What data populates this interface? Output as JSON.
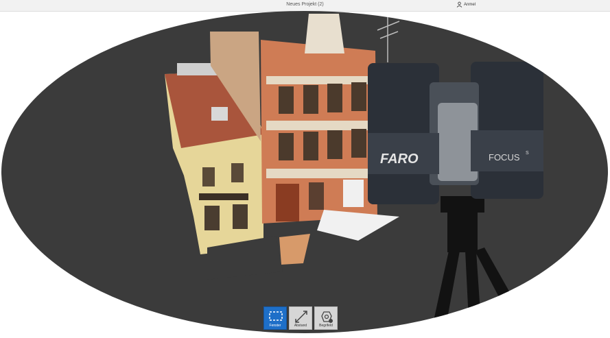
{
  "window": {
    "title": "Neues Projekt (2)"
  },
  "user": {
    "name": "Anmel",
    "icon": "user-icon"
  },
  "scanner": {
    "brand": "FARO",
    "model": "FOCUS",
    "model_sup": "S"
  },
  "toolbar": {
    "tools": [
      {
        "label": "Fenster",
        "icon": "window-select-icon",
        "active": true
      },
      {
        "label": "Abstand",
        "icon": "distance-icon",
        "active": false
      },
      {
        "label": "Begrifeld",
        "icon": "dimension-icon",
        "active": false
      }
    ]
  },
  "colors": {
    "background": "#3b3b3b",
    "active_tool": "#1e6fc8",
    "scanner_body": "#2b3038"
  }
}
